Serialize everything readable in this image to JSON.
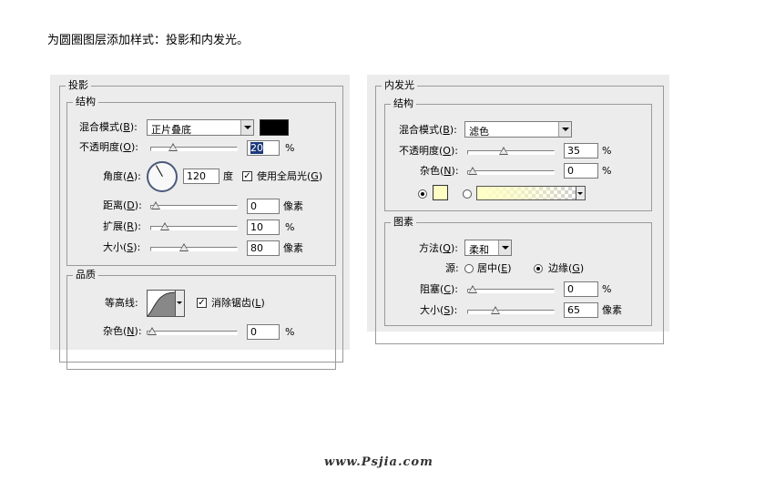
{
  "caption": "为圆圈图层添加样式：投影和内发光。",
  "watermark": "www.Psjia.com",
  "drop_shadow": {
    "title": "投影",
    "structure": {
      "title": "结构",
      "blend_mode": {
        "label": "混合模式(",
        "key": "B",
        "close": "):",
        "value": "正片叠底",
        "color": "#000000"
      },
      "opacity": {
        "label": "不透明度(",
        "key": "O",
        "close": "):",
        "value": "20",
        "unit": "%",
        "level": 0.2
      },
      "angle": {
        "label": "角度(",
        "key": "A",
        "close": "):",
        "value": "120",
        "unit": "度",
        "degrees": 120
      },
      "global_light": {
        "label": "使用全局光(",
        "key": "G",
        "close": ")",
        "checked": true,
        "mark": "✓"
      },
      "distance": {
        "label": "距离(",
        "key": "D",
        "close": "):",
        "value": "0",
        "unit": "像素",
        "level": 0.0
      },
      "spread": {
        "label": "扩展(",
        "key": "R",
        "close": "):",
        "value": "10",
        "unit": "%",
        "level": 0.1
      },
      "size": {
        "label": "大小(",
        "key": "S",
        "close": "):",
        "value": "80",
        "unit": "像素",
        "level": 0.32
      }
    },
    "quality": {
      "title": "品质",
      "contour": {
        "label": "等高线:"
      },
      "anti_alias": {
        "label": "消除锯齿(",
        "key": "L",
        "close": ")",
        "checked": true,
        "mark": "✓"
      },
      "noise": {
        "label": "杂色(",
        "key": "N",
        "close": "):",
        "value": "0",
        "unit": "%",
        "level": 0.0
      }
    }
  },
  "inner_glow": {
    "title": "内发光",
    "structure": {
      "title": "结构",
      "blend_mode": {
        "label": "混合模式(",
        "key": "B",
        "close": "):",
        "value": "滤色"
      },
      "opacity": {
        "label": "不透明度(",
        "key": "O",
        "close": "):",
        "value": "35",
        "unit": "%",
        "level": 0.35
      },
      "noise": {
        "label": "杂色(",
        "key": "N",
        "close": "):",
        "value": "0",
        "unit": "%",
        "level": 0.0
      },
      "color": "#ffffc4",
      "color_selected": "solid"
    },
    "elements": {
      "title": "图素",
      "technique": {
        "label": "方法(",
        "key": "Q",
        "close": "):",
        "value": "柔和"
      },
      "source": {
        "label": "源:",
        "center_label": "居中(",
        "center_key": "E",
        "center_close": ")",
        "edge_label": "边缘(",
        "edge_key": "G",
        "edge_close": ")",
        "selected": "edge"
      },
      "choke": {
        "label": "阻塞(",
        "key": "C",
        "close": "):",
        "value": "0",
        "unit": "%",
        "level": 0.0
      },
      "size": {
        "label": "大小(",
        "key": "S",
        "close": "):",
        "value": "65",
        "unit": "像素",
        "level": 0.26
      }
    }
  }
}
